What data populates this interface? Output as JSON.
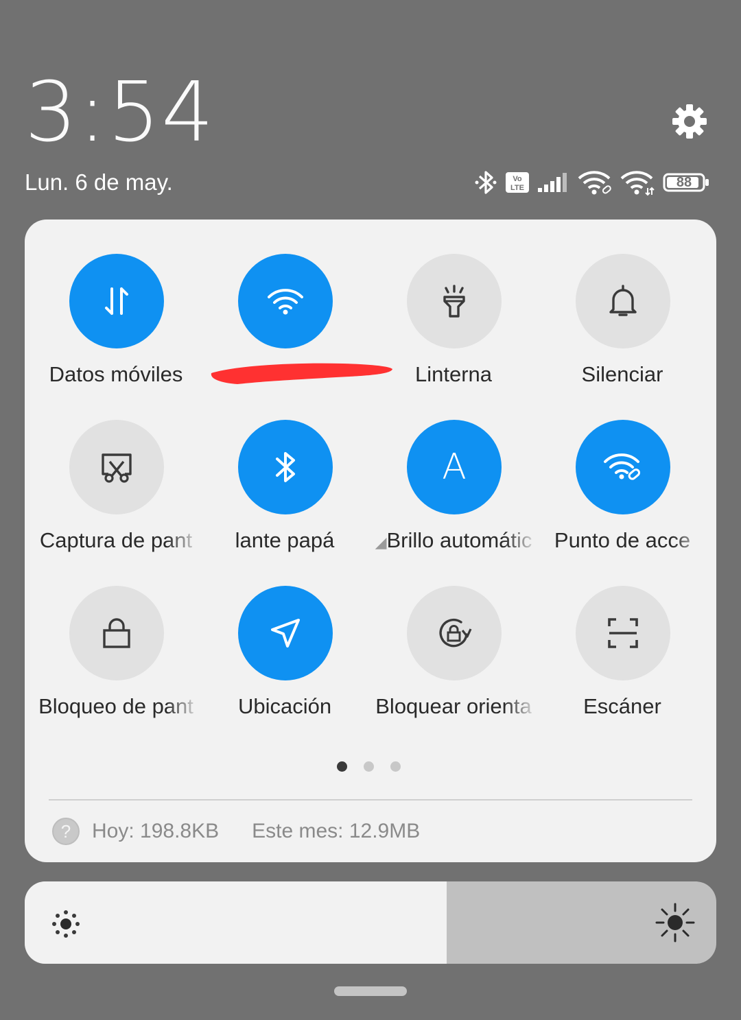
{
  "clock": {
    "time": "3:54",
    "date": "Lun. 6 de may."
  },
  "status_bar": {
    "icons": [
      "bluetooth-icon",
      "volte-icon",
      "signal-icon",
      "wifi-link-icon",
      "wifi-icon",
      "battery-icon"
    ],
    "volte_text": "Vo LTE",
    "battery_level": "88"
  },
  "tiles": [
    {
      "label": "Datos móviles",
      "icon": "mobile-data-icon",
      "on": true
    },
    {
      "label": "",
      "icon": "wifi-icon",
      "on": true,
      "redacted": true
    },
    {
      "label": "Linterna",
      "icon": "flashlight-icon",
      "on": false
    },
    {
      "label": "Silenciar",
      "icon": "bell-icon",
      "on": false
    },
    {
      "label": "Captura de pant",
      "icon": "screenshot-icon",
      "on": false
    },
    {
      "label": "lante papá",
      "icon": "bluetooth-icon",
      "on": true
    },
    {
      "label": "Brillo automátic",
      "icon": "auto-brightness-icon",
      "on": true
    },
    {
      "label": "Punto de acce",
      "icon": "hotspot-icon",
      "on": true
    },
    {
      "label": "Bloqueo de pant",
      "icon": "lock-icon",
      "on": false
    },
    {
      "label": "Ubicación",
      "icon": "location-icon",
      "on": true
    },
    {
      "label": "Bloquear orienta",
      "icon": "rotation-lock-icon",
      "on": false
    },
    {
      "label": "Escáner",
      "icon": "scanner-icon",
      "on": false
    }
  ],
  "auto_brightness_glyph": "A",
  "pager": {
    "pages": 3,
    "current": 1
  },
  "data_usage": {
    "help_glyph": "?",
    "today": "Hoy: 198.8KB",
    "month": "Este mes: 12.9MB"
  },
  "brightness": {
    "level": 0.61
  },
  "colors": {
    "background": "#717171",
    "panel": "#f2f2f2",
    "accent": "#0f91f2",
    "tile_off": "#e1e1e1",
    "redaction": "#ff3131"
  }
}
